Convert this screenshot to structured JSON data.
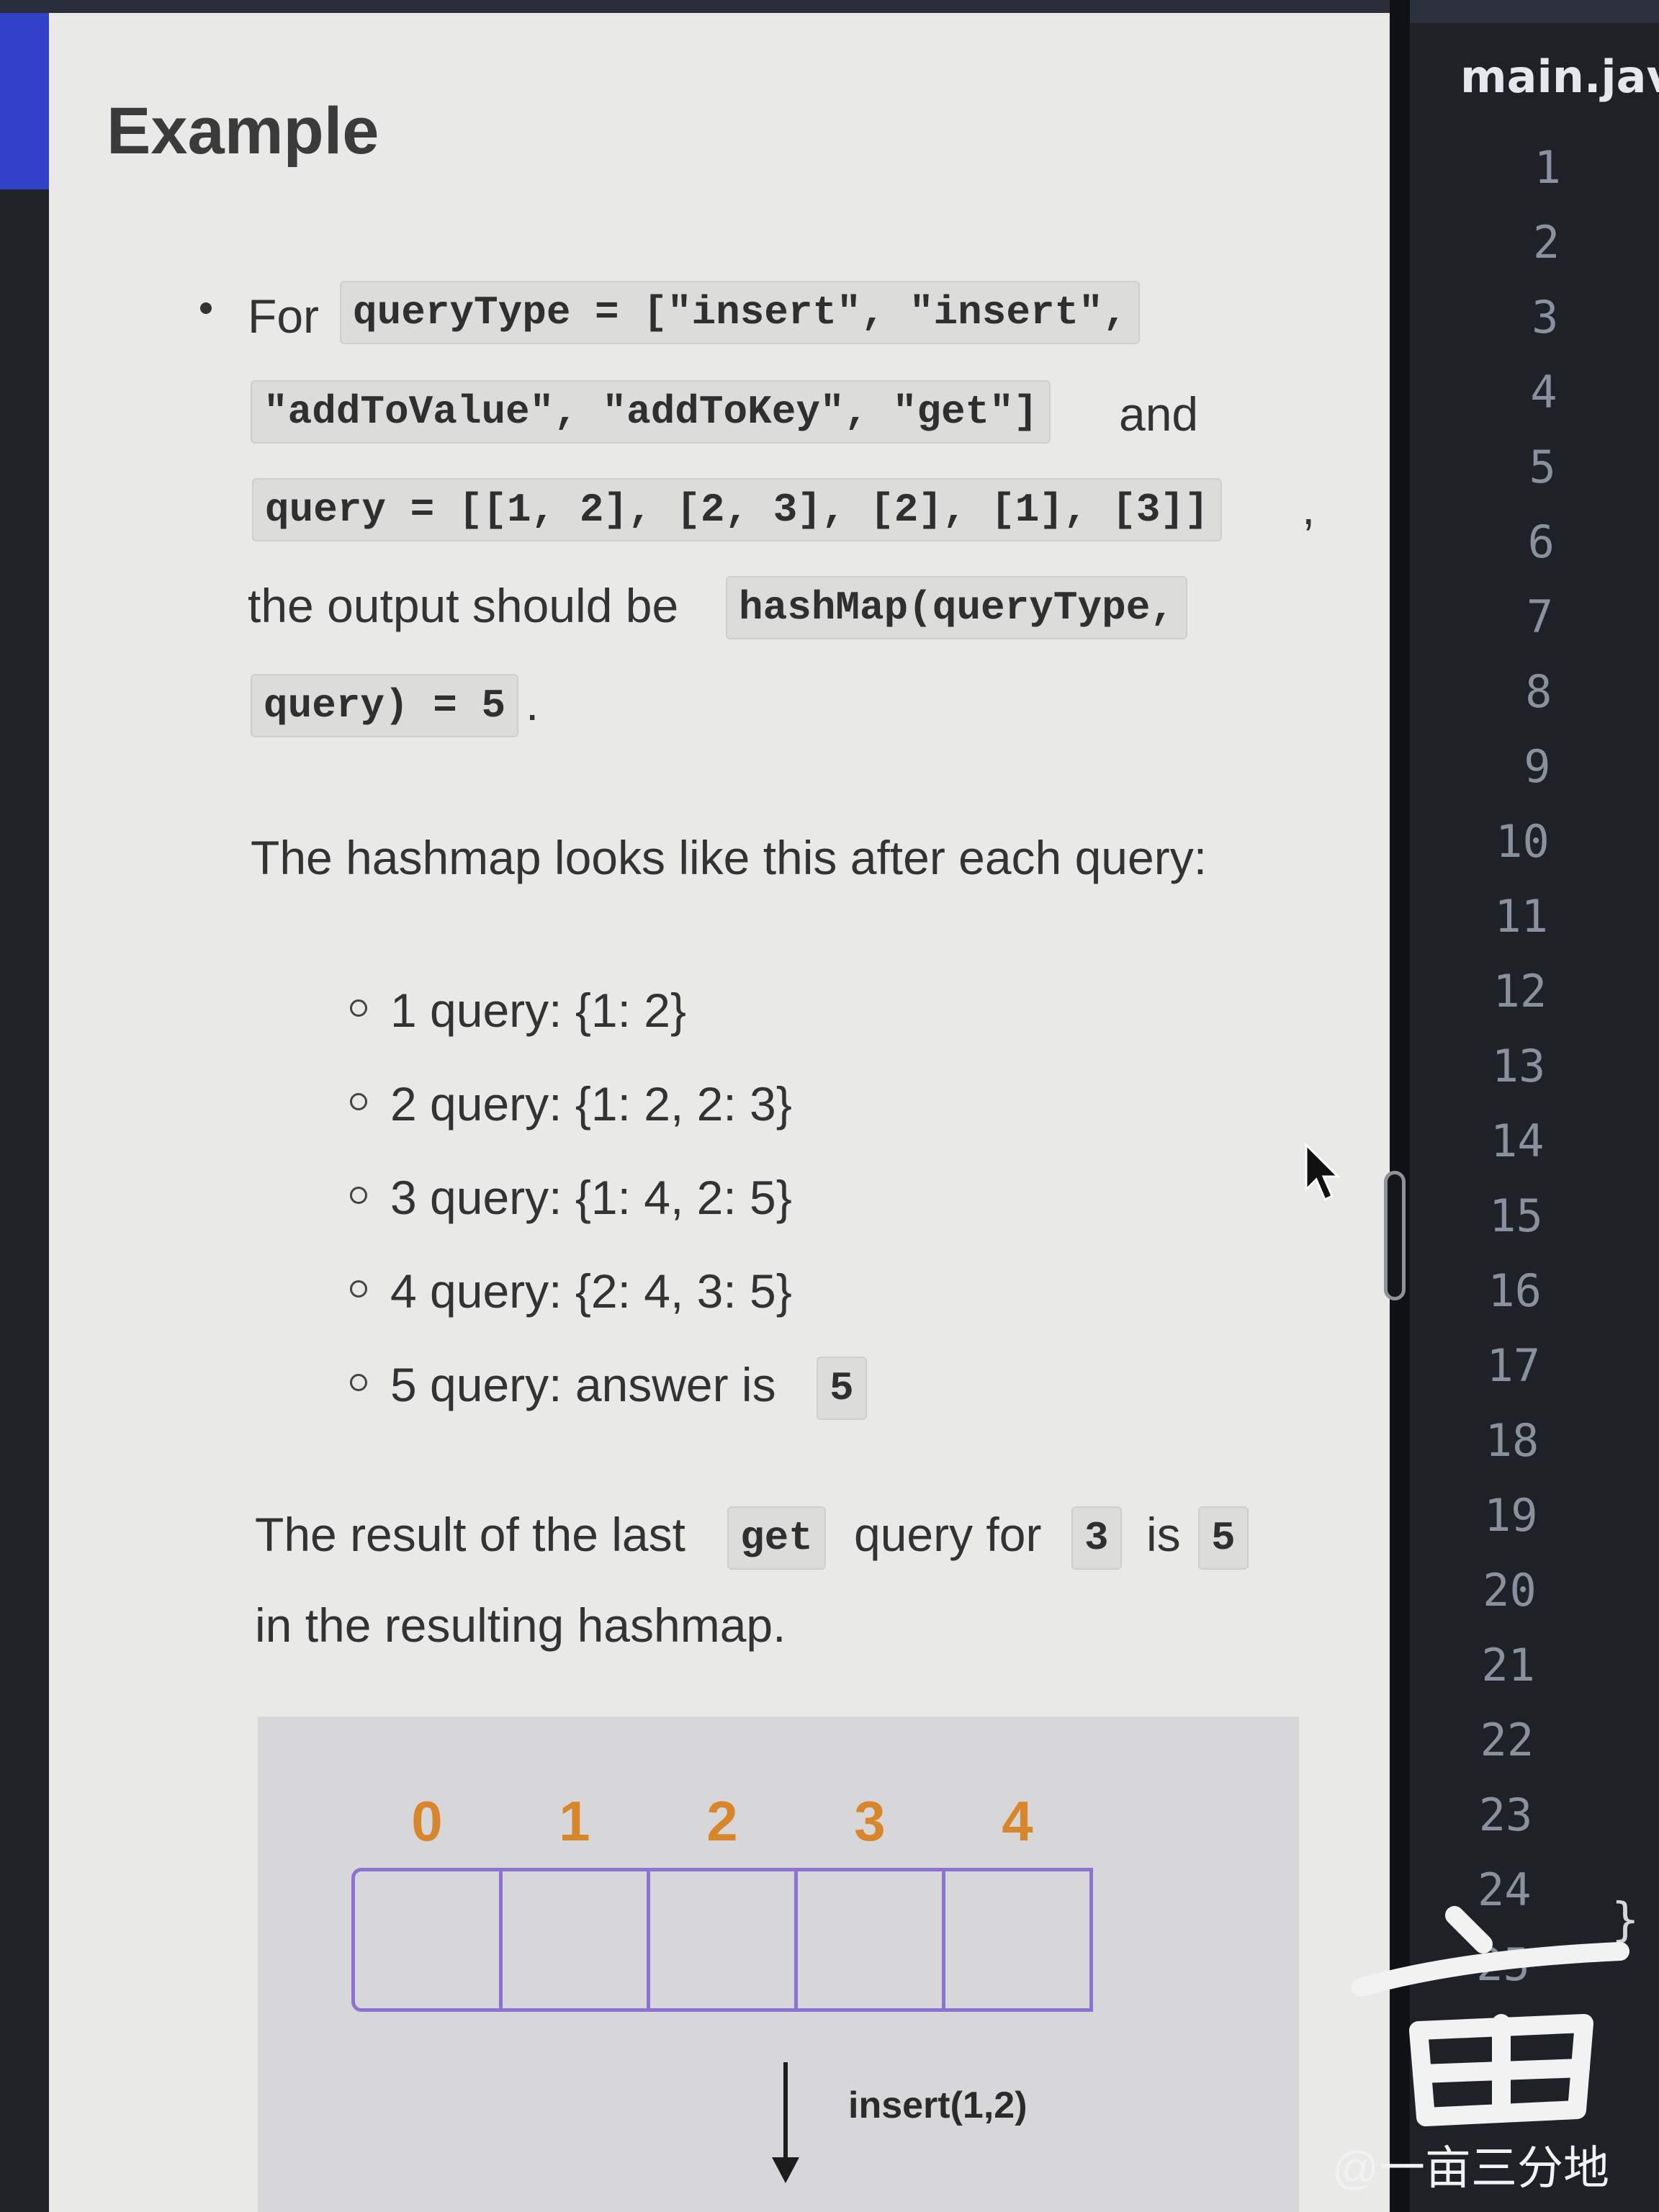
{
  "problem": {
    "heading": "Example",
    "example": {
      "for_word": "For",
      "code_query_type_part1": "queryType = [\"insert\", \"insert\",",
      "code_query_type_part2": "\"addToValue\", \"addToKey\", \"get\"]",
      "and_word": "and",
      "code_query": "query = [[1, 2], [2, 3], [2], [1], [3]]",
      "comma": ",",
      "output_text": "the output should be",
      "code_output_part1": "hashMap(queryType,",
      "code_output_part2": "query) = 5",
      "period": "."
    },
    "hashmap_intro": "The hashmap looks like this after each query:",
    "queries": [
      "1 query: {1: 2}",
      "2 query: {1: 2, 2: 3}",
      "3 query: {1: 4, 2: 5}",
      "4 query: {2: 4, 3: 5}",
      "5 query: answer is"
    ],
    "query5_code": "5",
    "result_line": {
      "part1": "The result of the last",
      "code_get": "get",
      "part2": "query for",
      "code_key": "3",
      "part3": "is",
      "code_value": "5",
      "part4": "in the resulting hashmap."
    }
  },
  "diagram": {
    "indices": [
      "0",
      "1",
      "2",
      "3",
      "4"
    ],
    "operation_label": "insert(1,2)",
    "index_color": "#d8862c",
    "cell_border_color": "#8d72d2"
  },
  "editor": {
    "tab_name": "main.jav",
    "line_numbers": [
      "1",
      "2",
      "3",
      "4",
      "5",
      "6",
      "7",
      "8",
      "9",
      "10",
      "11",
      "12",
      "13",
      "14",
      "15",
      "16",
      "17",
      "18",
      "19",
      "20",
      "21",
      "22",
      "23",
      "24",
      "25"
    ],
    "closing_brace": "}"
  },
  "watermark": "@一亩三分地"
}
